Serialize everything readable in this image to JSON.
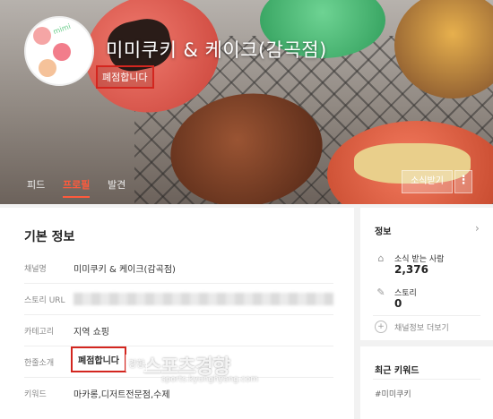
{
  "header": {
    "channel_name": "미미쿠키 & 케이크(감곡점)",
    "closed_badge": "폐점합니다",
    "avatar_text": "mimi"
  },
  "tabs": [
    {
      "label": "피드"
    },
    {
      "label": "프로필",
      "active": true
    },
    {
      "label": "발견"
    }
  ],
  "actions": {
    "subscribe_label": "소식받기",
    "more_label": "⋮"
  },
  "basic_info": {
    "title": "기본 정보",
    "rows": [
      {
        "label": "채널명",
        "value": "미미쿠키 & 케이크(감곡점)"
      },
      {
        "label": "스토리 URL",
        "value": ""
      },
      {
        "label": "카테고리",
        "value": "지역 쇼핑"
      },
      {
        "label": "한줄소개",
        "value": "폐점합니다"
      },
      {
        "label": "키워드",
        "value": "마카롱,디저트전문점,수제"
      }
    ]
  },
  "sidebar": {
    "info_title": "정보",
    "subscribers_label": "소식 받는 사람",
    "subscribers_value": "2,376",
    "stories_label": "스토리",
    "stories_value": "0",
    "more_link": "채널정보 더보기",
    "recent_keywords_title": "최근 키워드",
    "recent_keyword": "#미미쿠키"
  },
  "watermark": {
    "logo": "스포츠경향",
    "mark": "경향",
    "url": "sports.kyunghyang.com"
  },
  "colors": {
    "accent": "#ff5a3c",
    "highlight_box": "#d3261f"
  }
}
